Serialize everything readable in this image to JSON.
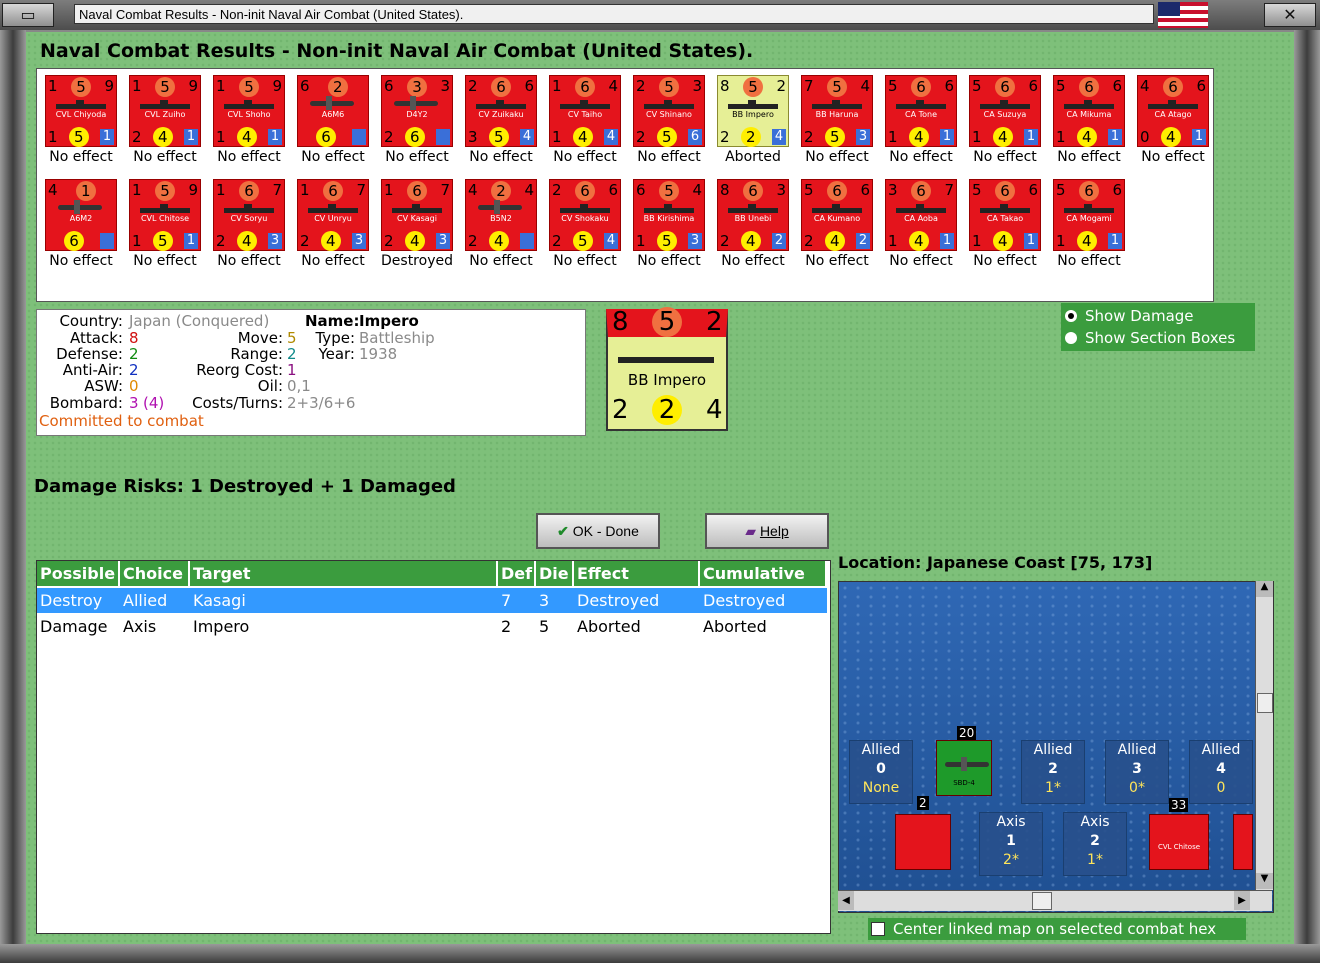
{
  "window": {
    "title": "Naval Combat Results - Non-init Naval Air Combat (United States)."
  },
  "heading": "Naval Combat Results - Non-init Naval Air Combat (United States).",
  "units_row1": [
    {
      "top": [
        "1",
        "5",
        "9"
      ],
      "name": "CVL Chiyoda",
      "bot": [
        "1",
        "5",
        "1"
      ],
      "kind": "ship",
      "result": "No effect"
    },
    {
      "top": [
        "1",
        "5",
        "9"
      ],
      "name": "CVL Zuiho",
      "bot": [
        "2",
        "4",
        "1"
      ],
      "kind": "ship",
      "result": "No effect"
    },
    {
      "top": [
        "1",
        "5",
        "9"
      ],
      "name": "CVL Shoho",
      "bot": [
        "1",
        "4",
        "1"
      ],
      "kind": "ship",
      "result": "No effect"
    },
    {
      "top": [
        "6",
        "2",
        ""
      ],
      "name": "A6M6",
      "bot": [
        "",
        "6",
        ""
      ],
      "kind": "plane",
      "result": "No effect"
    },
    {
      "top": [
        "6",
        "3",
        "3"
      ],
      "name": "D4Y2",
      "bot": [
        "2",
        "6",
        ""
      ],
      "kind": "plane",
      "result": "No effect"
    },
    {
      "top": [
        "2",
        "6",
        "6"
      ],
      "name": "CV Zuikaku",
      "bot": [
        "3",
        "5",
        "4"
      ],
      "kind": "ship",
      "result": "No effect"
    },
    {
      "top": [
        "1",
        "6",
        "4"
      ],
      "name": "CV Taiho",
      "bot": [
        "1",
        "4",
        "4"
      ],
      "kind": "ship",
      "result": "No effect"
    },
    {
      "top": [
        "2",
        "5",
        "3"
      ],
      "name": "CV Shinano",
      "bot": [
        "2",
        "5",
        "6"
      ],
      "kind": "ship",
      "result": "No effect"
    },
    {
      "top": [
        "8",
        "5",
        "2"
      ],
      "name": "BB Impero",
      "bot": [
        "2",
        "2",
        "4"
      ],
      "kind": "ship",
      "result": "Aborted",
      "highlight": true
    },
    {
      "top": [
        "7",
        "5",
        "4"
      ],
      "name": "BB Haruna",
      "bot": [
        "2",
        "5",
        "3"
      ],
      "kind": "ship",
      "result": "No effect"
    },
    {
      "top": [
        "5",
        "6",
        "6"
      ],
      "name": "CA Tone",
      "bot": [
        "1",
        "4",
        "1"
      ],
      "kind": "ship",
      "result": "No effect"
    },
    {
      "top": [
        "5",
        "6",
        "6"
      ],
      "name": "CA Suzuya",
      "bot": [
        "1",
        "4",
        "1"
      ],
      "kind": "ship",
      "result": "No effect"
    },
    {
      "top": [
        "5",
        "6",
        "6"
      ],
      "name": "CA Mikuma",
      "bot": [
        "1",
        "4",
        "1"
      ],
      "kind": "ship",
      "result": "No effect"
    },
    {
      "top": [
        "4",
        "6",
        "6"
      ],
      "name": "CA Atago",
      "bot": [
        "0",
        "4",
        "1"
      ],
      "kind": "ship",
      "result": "No effect"
    }
  ],
  "units_row2": [
    {
      "top": [
        "4",
        "1",
        ""
      ],
      "name": "A6M2",
      "bot": [
        "",
        "6",
        ""
      ],
      "kind": "plane",
      "result": "No effect"
    },
    {
      "top": [
        "1",
        "5",
        "9"
      ],
      "name": "CVL Chitose",
      "bot": [
        "1",
        "5",
        "1"
      ],
      "kind": "ship",
      "result": "No effect"
    },
    {
      "top": [
        "1",
        "6",
        "7"
      ],
      "name": "CV Soryu",
      "bot": [
        "2",
        "4",
        "3"
      ],
      "kind": "ship",
      "result": "No effect"
    },
    {
      "top": [
        "1",
        "6",
        "7"
      ],
      "name": "CV Unryu",
      "bot": [
        "2",
        "4",
        "3"
      ],
      "kind": "ship",
      "result": "No effect"
    },
    {
      "top": [
        "1",
        "6",
        "7"
      ],
      "name": "CV Kasagi",
      "bot": [
        "2",
        "4",
        "3"
      ],
      "kind": "ship",
      "result": "Destroyed"
    },
    {
      "top": [
        "4",
        "2",
        "4"
      ],
      "name": "B5N2",
      "bot": [
        "2",
        "4",
        ""
      ],
      "kind": "plane",
      "result": "No effect"
    },
    {
      "top": [
        "2",
        "6",
        "6"
      ],
      "name": "CV Shokaku",
      "bot": [
        "2",
        "5",
        "4"
      ],
      "kind": "ship",
      "result": "No effect"
    },
    {
      "top": [
        "6",
        "5",
        "4"
      ],
      "name": "BB Kirishima",
      "bot": [
        "1",
        "5",
        "3"
      ],
      "kind": "ship",
      "result": "No effect"
    },
    {
      "top": [
        "8",
        "6",
        "3"
      ],
      "name": "BB Unebi",
      "bot": [
        "2",
        "4",
        "2"
      ],
      "kind": "ship",
      "result": "No effect"
    },
    {
      "top": [
        "5",
        "6",
        "6"
      ],
      "name": "CA Kumano",
      "bot": [
        "2",
        "4",
        "2"
      ],
      "kind": "ship",
      "result": "No effect"
    },
    {
      "top": [
        "3",
        "6",
        "7"
      ],
      "name": "CA Aoba",
      "bot": [
        "1",
        "4",
        "1"
      ],
      "kind": "ship",
      "result": "No effect"
    },
    {
      "top": [
        "5",
        "6",
        "6"
      ],
      "name": "CA Takao",
      "bot": [
        "1",
        "4",
        "1"
      ],
      "kind": "ship",
      "result": "No effect"
    },
    {
      "top": [
        "5",
        "6",
        "6"
      ],
      "name": "CA Mogami",
      "bot": [
        "1",
        "4",
        "1"
      ],
      "kind": "ship",
      "result": "No effect"
    }
  ],
  "info": {
    "country_label": "Country:",
    "country": "Japan (Conquered)",
    "attack_label": "Attack:",
    "attack": "8",
    "defense_label": "Defense:",
    "defense": "2",
    "antiair_label": "Anti-Air:",
    "antiair": "2",
    "asw_label": "ASW:",
    "asw": "0",
    "bombard_label": "Bombard:",
    "bombard": "3",
    "bombard_extra": "(4)",
    "committed": "Committed to combat",
    "move_label": "Move:",
    "move": "5",
    "range_label": "Range:",
    "range": "2",
    "reorg_label": "Reorg Cost:",
    "reorg": "1",
    "oil_label": "Oil:",
    "oil": "0,1",
    "costs_label": "Costs/Turns:",
    "costs": "2+3/6+6",
    "name_label": "Name:",
    "name": "Impero",
    "type_label": "Type:",
    "type": "Battleship",
    "year_label": "Year:",
    "year": "1938"
  },
  "big_counter": {
    "top_left": "8",
    "top_mid": "5",
    "top_right": "2",
    "name": "BB Impero",
    "bot_left": "2",
    "bot_mid": "2",
    "bot_right": "4"
  },
  "options": {
    "show_damage": "Show Damage",
    "show_section": "Show Section Boxes"
  },
  "risks": "Damage Risks:  1 Destroyed + 1 Damaged",
  "buttons": {
    "ok": "OK - Done",
    "help": "Help"
  },
  "table": {
    "headers": [
      "Possible",
      "Choice",
      "Target",
      "Def",
      "Die",
      "Effect",
      "Cumulative"
    ],
    "rows": [
      [
        "Destroy",
        "Allied",
        "Kasagi",
        "7",
        "3",
        "Destroyed",
        "Destroyed"
      ],
      [
        "Damage",
        "Axis",
        "Impero",
        "2",
        "5",
        "Aborted",
        "Aborted"
      ]
    ]
  },
  "location": "Location:  Japanese Coast [75, 173]",
  "map": {
    "boxes": [
      {
        "side": "Allied",
        "num": "0",
        "sub": "None"
      },
      {
        "side": "Allied",
        "num": "2",
        "sub": "1*"
      },
      {
        "side": "Allied",
        "num": "3",
        "sub": "0*"
      },
      {
        "side": "Allied",
        "num": "4",
        "sub": "0"
      },
      {
        "side": "Axis",
        "num": "1",
        "sub": "2*"
      },
      {
        "side": "Axis",
        "num": "2",
        "sub": "1*"
      }
    ],
    "stack_20": "20",
    "stack_2": "2",
    "stack_33": "33",
    "plane_name": "SBD-4",
    "chitose_name": "CVL Chitose"
  },
  "center_linked": "Center linked map on selected combat hex"
}
